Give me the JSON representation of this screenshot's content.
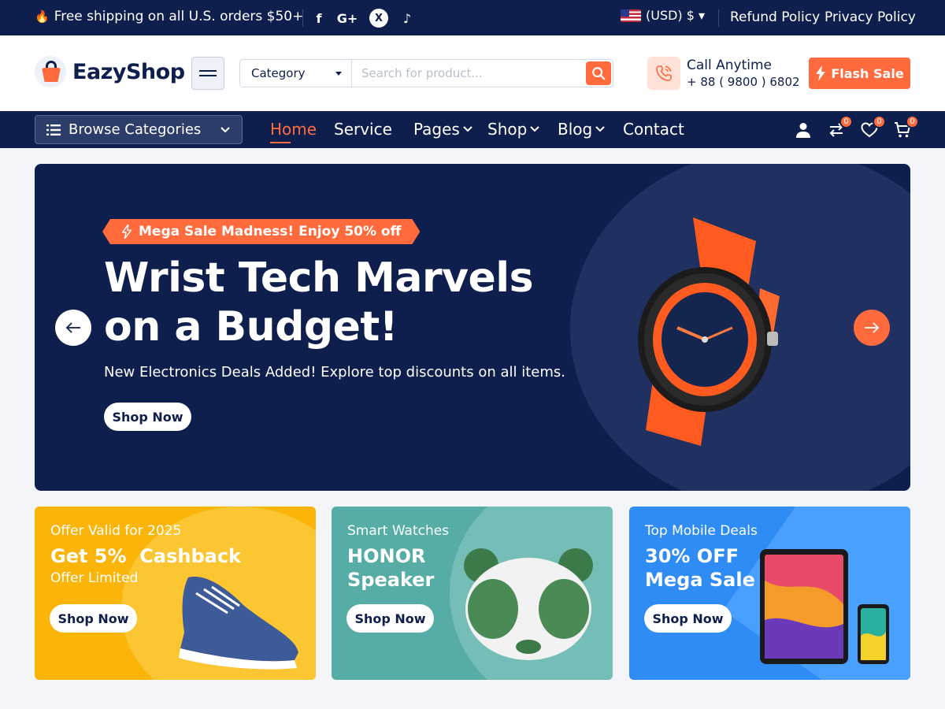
{
  "topbar": {
    "shipping_text": "Free shipping on all U.S. orders $50+",
    "social": [
      "f",
      "G+",
      "X",
      "♪"
    ],
    "currency": "(USD) $ ▾",
    "refund_link": "Refund Policy",
    "privacy_link": "Privacy Policy"
  },
  "header": {
    "logo_text": "EazyShop",
    "category_label": "Category",
    "search_placeholder": "Search for product...",
    "call_title": "Call Anytime",
    "call_number": "+ 88 ( 9800 ) 6802",
    "flash_sale_label": "Flash Sale"
  },
  "nav": {
    "browse_label": "Browse Categories",
    "items": [
      {
        "label": "Home"
      },
      {
        "label": "Service"
      },
      {
        "label": "Pages"
      },
      {
        "label": "Shop"
      },
      {
        "label": "Blog"
      },
      {
        "label": "Contact"
      }
    ],
    "compare_count": "0",
    "wishlist_count": "0",
    "cart_count": "0"
  },
  "hero": {
    "ribbon": "Mega Sale Madness! Enjoy 50% off",
    "title_line1": "Wrist Tech Marvels",
    "title_line2": "on a Budget!",
    "subtitle": "New Electronics Deals Added! Explore top discounts on all items.",
    "cta": "Shop Now"
  },
  "cards": [
    {
      "eyebrow": "Offer Valid for 2025",
      "headline": "Get 5%  Cashback",
      "sub": "Offer Limited",
      "cta": "Shop Now"
    },
    {
      "eyebrow": "Smart Watches",
      "headline_line1": "HONOR",
      "headline_line2": "Speaker",
      "cta": "Shop Now"
    },
    {
      "eyebrow": "Top Mobile Deals",
      "headline_line1": "30% OFF",
      "headline_line2": "Mega Sale",
      "cta": "Shop Now"
    }
  ],
  "colors": {
    "navy": "#0e1f4d",
    "accent": "#ff6b3d",
    "yellow": "#fbb40a",
    "teal": "#56ada5",
    "blue": "#2f8cf4"
  }
}
